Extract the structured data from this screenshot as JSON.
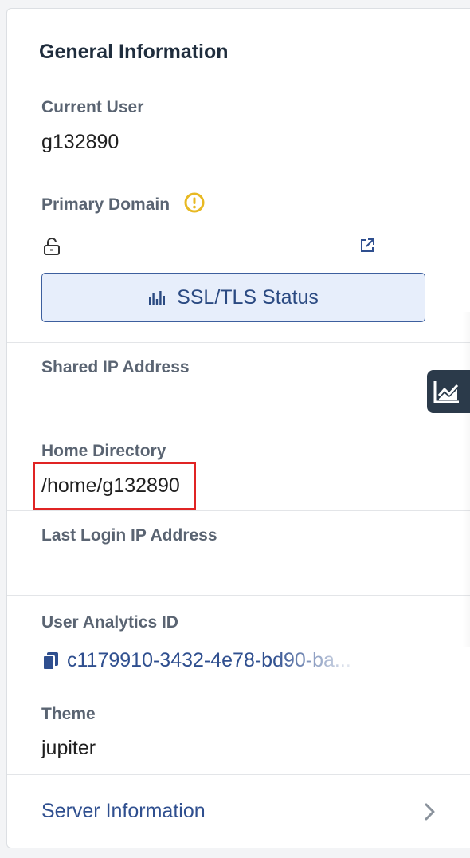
{
  "panel": {
    "title": "General Information"
  },
  "current_user": {
    "label": "Current User",
    "value": "g132890"
  },
  "primary_domain": {
    "label": "Primary Domain",
    "warning_icon": "warning-circle-icon",
    "lock_icon": "unlocked-icon",
    "external_link_icon": "external-link-icon",
    "ssl_button_label": "SSL/TLS Status",
    "ssl_button_icon": "bar-chart-icon"
  },
  "shared_ip": {
    "label": "Shared IP Address",
    "value": ""
  },
  "home_directory": {
    "label": "Home Directory",
    "value": "/home/g132890"
  },
  "last_login_ip": {
    "label": "Last Login IP Address",
    "value": ""
  },
  "user_analytics": {
    "label": "User Analytics ID",
    "copy_icon": "copy-icon",
    "value": "c1179910-3432-4e78-bd90-ba..."
  },
  "theme": {
    "label": "Theme",
    "value": "jupiter"
  },
  "server_information": {
    "label": "Server Information",
    "icon": "chevron-right-icon"
  },
  "side_tab": {
    "icon": "line-chart-icon"
  },
  "colors": {
    "title": "#1f2d3d",
    "label": "#5a6472",
    "link": "#2f4f8f",
    "warning": "#e8b923",
    "button_bg": "#e7eefb",
    "button_border": "#3d5f9e",
    "highlight": "#e02424",
    "side_tab": "#2b3a4a"
  }
}
